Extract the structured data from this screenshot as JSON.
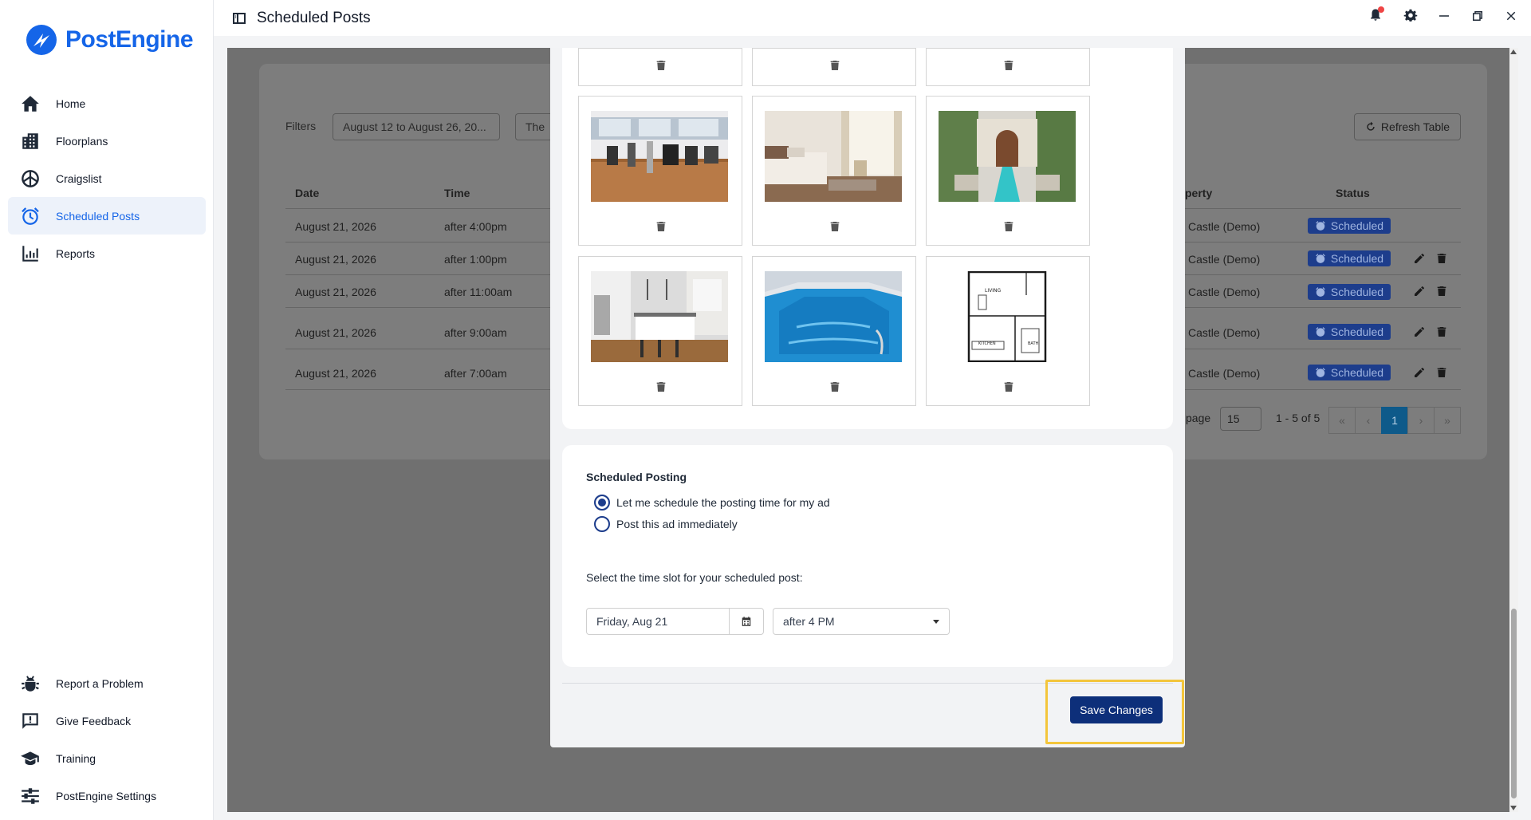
{
  "app": {
    "brand": "PostEngine",
    "page_title": "Scheduled Posts",
    "accent_color": "#1565e8",
    "primary_button_color": "#0d2f7a"
  },
  "sidebar": {
    "items": [
      {
        "label": "Home",
        "icon": "home-icon"
      },
      {
        "label": "Floorplans",
        "icon": "building-icon"
      },
      {
        "label": "Craigslist",
        "icon": "peace-icon"
      },
      {
        "label": "Scheduled Posts",
        "icon": "alarm-clock-icon",
        "active": true
      },
      {
        "label": "Reports",
        "icon": "bar-chart-icon"
      }
    ],
    "bottom_items": [
      {
        "label": "Report a Problem",
        "icon": "bug-icon"
      },
      {
        "label": "Give Feedback",
        "icon": "feedback-icon"
      },
      {
        "label": "Training",
        "icon": "graduation-cap-icon"
      },
      {
        "label": "PostEngine Settings",
        "icon": "sliders-icon"
      }
    ]
  },
  "topbar": {
    "icons": [
      "sidebar-toggle-icon",
      "bell-icon",
      "gear-icon",
      "minimize-icon",
      "restore-icon",
      "close-icon"
    ]
  },
  "background_table": {
    "filters_label": "Filters",
    "date_filter": "August 12 to August 26, 20...",
    "second_filter": "The",
    "refresh_label": "Refresh Table",
    "headers": {
      "date": "Date",
      "time": "Time",
      "property": "perty",
      "status": "Status"
    },
    "rows": [
      {
        "date": "August 21, 2026",
        "time": "after 4:00pm",
        "property": "Castle (Demo)",
        "status": "Scheduled"
      },
      {
        "date": "August 21, 2026",
        "time": "after 1:00pm",
        "property": "Castle (Demo)",
        "status": "Scheduled"
      },
      {
        "date": "August 21, 2026",
        "time": "after 11:00am",
        "property": "Castle (Demo)",
        "status": "Scheduled"
      },
      {
        "date": "August 21, 2026",
        "time": "after 9:00am",
        "property": "Castle (Demo)",
        "status": "Scheduled"
      },
      {
        "date": "August 21, 2026",
        "time": "after 7:00am",
        "property": "Castle (Demo)",
        "status": "Scheduled"
      }
    ],
    "pager": {
      "per_page_label": "page",
      "per_page": "15",
      "range": "1 - 5 of 5",
      "current_page": "1"
    }
  },
  "modal": {
    "photos": [
      {
        "name": "gym-photo"
      },
      {
        "name": "bedroom-photo"
      },
      {
        "name": "courtyard-pool-photo"
      },
      {
        "name": "kitchen-photo"
      },
      {
        "name": "indoor-pool-photo"
      },
      {
        "name": "floorplan-image"
      }
    ],
    "floorplan_labels": {
      "living": "LIVING",
      "kitchen": "KITCHEN",
      "bath": "BATH"
    },
    "scheduled_posting": {
      "title": "Scheduled Posting",
      "options": [
        {
          "label": "Let me schedule the posting time for my ad",
          "selected": true
        },
        {
          "label": "Post this ad immediately",
          "selected": false
        }
      ],
      "slot_label": "Select the time slot for your scheduled post:",
      "date_value": "Friday, Aug 21",
      "time_value": "after 4 PM"
    },
    "save_label": "Save Changes"
  }
}
